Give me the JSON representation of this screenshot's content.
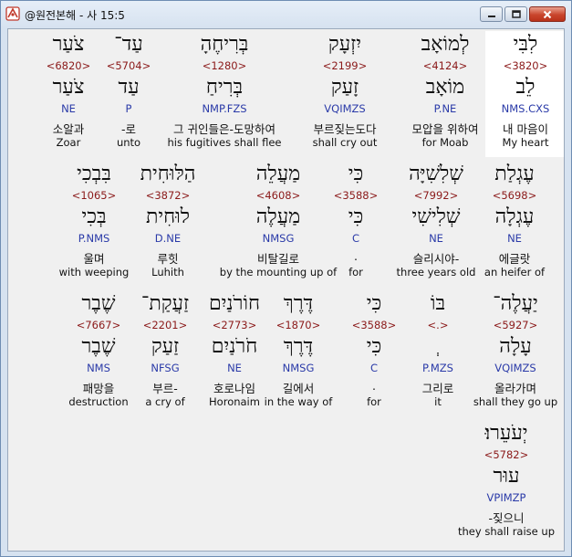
{
  "window": {
    "title": "@원전본해 - 사 15:5",
    "buttons": [
      "minimize",
      "maximize",
      "close"
    ]
  },
  "rows": [
    {
      "words": [
        {
          "hebrew": "לִבִּי",
          "strong": "<3820>",
          "lemma": "לֵב",
          "parse": "NMS.CXS",
          "korean": "내 마음이",
          "english": "My heart",
          "highlight": true
        },
        {
          "hebrew": "לְמוֹאָב",
          "strong": "<4124>",
          "lemma": "מוֹאָב",
          "parse": "P.NE",
          "korean": "모압을 위하여",
          "english": "for Moab"
        },
        {
          "hebrew": "יִזְעָק",
          "strong": "<2199>",
          "lemma": "זָעַק",
          "parse": "VQIMZS",
          "korean": "부르짖는도다",
          "english": "shall cry out"
        },
        {
          "hebrew": "בְּרִיחֶהָ",
          "strong": "<1280>",
          "lemma": "בְּרִיחַ",
          "parse": "NMP.FZS",
          "korean": "그 귀인들은-도망하여",
          "english": "his fugitives shall flee"
        },
        {
          "hebrew": "עַד־",
          "strong": "<5704>",
          "lemma": "עַד",
          "parse": "P",
          "korean": "-로",
          "english": "unto"
        },
        {
          "hebrew": "צֹעַר",
          "strong": "<6820>",
          "lemma": "צֹעַר",
          "parse": "NE",
          "korean": "소알과",
          "english": "Zoar"
        }
      ]
    },
    {
      "words": [
        {
          "hebrew": "עֶגְלַת",
          "strong": "<5698>",
          "lemma": "עֶגְלָה",
          "parse": "NE",
          "korean": "에글랏",
          "english": "an heifer of"
        },
        {
          "hebrew": "שְׁלִשִׁיָּה",
          "strong": "<7992>",
          "lemma": "שְׁלִישִׁי",
          "parse": "NE",
          "korean": "슬리시야-",
          "english": "three years old"
        },
        {
          "hebrew": "כִּי",
          "strong": "<3588>",
          "lemma": "כִּי",
          "parse": "C",
          "korean": ".",
          "english": "for"
        },
        {
          "hebrew": "מַעֲלֵה",
          "strong": "<4608>",
          "lemma": "מַעֲלֶה",
          "parse": "NMSG",
          "korean": "비탈길로",
          "english": "by the mounting up of"
        },
        {
          "hebrew": "הַלּוּחִית",
          "strong": "<3872>",
          "lemma": "לוּחִית",
          "parse": "D.NE",
          "korean": "루힛",
          "english": "Luhith"
        },
        {
          "hebrew": "בִּבְכִי",
          "strong": "<1065>",
          "lemma": "בְּכִי",
          "parse": "P.NMS",
          "korean": "울며",
          "english": "with weeping"
        }
      ]
    },
    {
      "words": [
        {
          "hebrew": "יַעֲלֶה־",
          "strong": "<5927>",
          "lemma": "עָלָה",
          "parse": "VQIMZS",
          "korean": "올라가며",
          "english": "shall they go up"
        },
        {
          "hebrew": "בּוֹ",
          "strong": "<.>",
          "lemma": "ְ",
          "parse": "P.MZS",
          "korean": "그리로",
          "english": "it"
        },
        {
          "hebrew": "כִּי",
          "strong": "<3588>",
          "lemma": "כִּי",
          "parse": "C",
          "korean": ".",
          "english": "for"
        },
        {
          "hebrew": "דֶּרֶךְ",
          "strong": "<1870>",
          "lemma": "דֶּרֶךְ",
          "parse": "NMSG",
          "korean": "길에서",
          "english": "in the way of"
        },
        {
          "hebrew": "חוֹרֹנַיִם",
          "strong": "<2773>",
          "lemma": "חֹרֹנַיִם",
          "parse": "NE",
          "korean": "호로나임",
          "english": "Horonaim"
        },
        {
          "hebrew": "זַעֲקַת־",
          "strong": "<2201>",
          "lemma": "זַעַק",
          "parse": "NFSG",
          "korean": "부르-",
          "english": "a cry of"
        },
        {
          "hebrew": "שֶׁבֶר",
          "strong": "<7667>",
          "lemma": "שֶׁבֶר",
          "parse": "NMS",
          "korean": "패망을",
          "english": "destruction"
        }
      ]
    },
    {
      "words": [
        {
          "hebrew": "יְעֹעֵרוּ׃",
          "strong": "<5782>",
          "lemma": "עוּר",
          "parse": "VPIMZP",
          "korean": "-짖으니",
          "english": "they shall raise up"
        }
      ]
    }
  ]
}
